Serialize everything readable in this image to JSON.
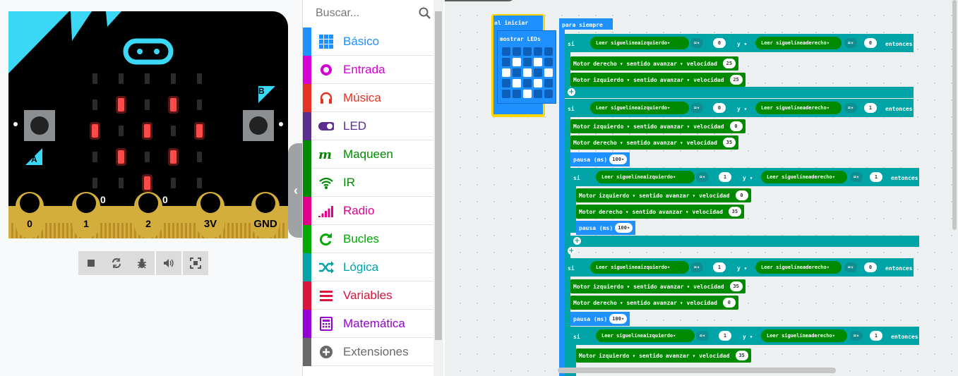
{
  "simulator": {
    "pins": [
      "0",
      "1",
      "2",
      "3V",
      "GND"
    ],
    "pin_values": [
      "0",
      "0"
    ],
    "button_a": "A",
    "button_b": "B",
    "led_matrix": [
      [
        0,
        0,
        0,
        0,
        0
      ],
      [
        0,
        1,
        0,
        1,
        0
      ],
      [
        1,
        0,
        1,
        0,
        1
      ],
      [
        0,
        1,
        0,
        1,
        0
      ],
      [
        0,
        0,
        1,
        0,
        0
      ]
    ],
    "toolbar": [
      "stop-icon",
      "restart-icon",
      "debug-icon",
      "sound-icon",
      "fullscreen-icon"
    ]
  },
  "toolbox": {
    "search_placeholder": "Buscar...",
    "categories": [
      {
        "label": "Básico",
        "color": "#1e90ff",
        "icon": "grid-icon"
      },
      {
        "label": "Entrada",
        "color": "#d400d4",
        "icon": "circle-icon"
      },
      {
        "label": "Música",
        "color": "#e63022",
        "icon": "headphones-icon"
      },
      {
        "label": "LED",
        "color": "#5c2d91",
        "icon": "toggle-icon"
      },
      {
        "label": "Maqueen",
        "color": "#008a00",
        "icon": "maqueen-icon"
      },
      {
        "label": "IR",
        "color": "#008a00",
        "icon": "wifi-icon"
      },
      {
        "label": "Radio",
        "color": "#e3008c",
        "icon": "signal-bars-icon"
      },
      {
        "label": "Bucles",
        "color": "#00aa00",
        "icon": "loop-icon"
      },
      {
        "label": "Lógica",
        "color": "#00a4a6",
        "icon": "shuffle-icon"
      },
      {
        "label": "Variables",
        "color": "#dc143c",
        "icon": "list-icon"
      },
      {
        "label": "Matemática",
        "color": "#9400d3",
        "icon": "calculator-icon"
      },
      {
        "label": "Extensiones",
        "color": "#696969",
        "icon": "plus-circle-icon"
      }
    ]
  },
  "workspace": {
    "on_start": {
      "label": "al iniciar",
      "show_leds": "mostrar LEDs"
    },
    "forever": {
      "label": "para siempre"
    },
    "kw": {
      "si": "si",
      "y": "y",
      "entonces": "entonces",
      "read": "Leer siguelínea",
      "motor": "Motor",
      "sentido": "sentido",
      "avanzar": "avanzar",
      "velocidad": "velocidad",
      "pausa": "pausa (ms)",
      "eq": "="
    },
    "blocks": [
      {
        "if": "si",
        "left": "izquierdo",
        "lv": "0",
        "right": "derecho",
        "rv": "0",
        "then": "entonces"
      },
      {
        "motor": "derecho",
        "speed": "25"
      },
      {
        "motor": "izquierdo",
        "speed": "25"
      },
      {
        "if": "si",
        "left": "izquierdo",
        "lv": "0",
        "right": "derecho",
        "rv": "1",
        "then": "entonces"
      },
      {
        "motor": "izquierdo",
        "speed": "0"
      },
      {
        "motor": "derecho",
        "speed": "35"
      },
      {
        "pause": "100"
      },
      {
        "if": "si",
        "left": "izquierdo",
        "lv": "1",
        "right": "derecho",
        "rv": "1",
        "then": "entonces"
      },
      {
        "motor": "izquierdo",
        "speed": "0"
      },
      {
        "motor": "derecho",
        "speed": "35"
      },
      {
        "pause": "100"
      },
      {
        "if": "si",
        "left": "izquierdo",
        "lv": "1",
        "right": "derecho",
        "rv": "0",
        "then": "entonces"
      },
      {
        "motor": "izquierdo",
        "speed": "35"
      },
      {
        "motor": "derecho",
        "speed": "0"
      },
      {
        "pause": "100"
      },
      {
        "if": "si",
        "left": "izquierdo",
        "lv": "1",
        "right": "derecho",
        "rv": "1",
        "then": "entonces"
      },
      {
        "motor": "izquierdo",
        "speed": "35"
      }
    ]
  },
  "colors": {
    "logic": "#00a4a6",
    "maqueen": "#008a00",
    "basic": "#1e90ff",
    "onstart_outline": "#ffd400"
  }
}
